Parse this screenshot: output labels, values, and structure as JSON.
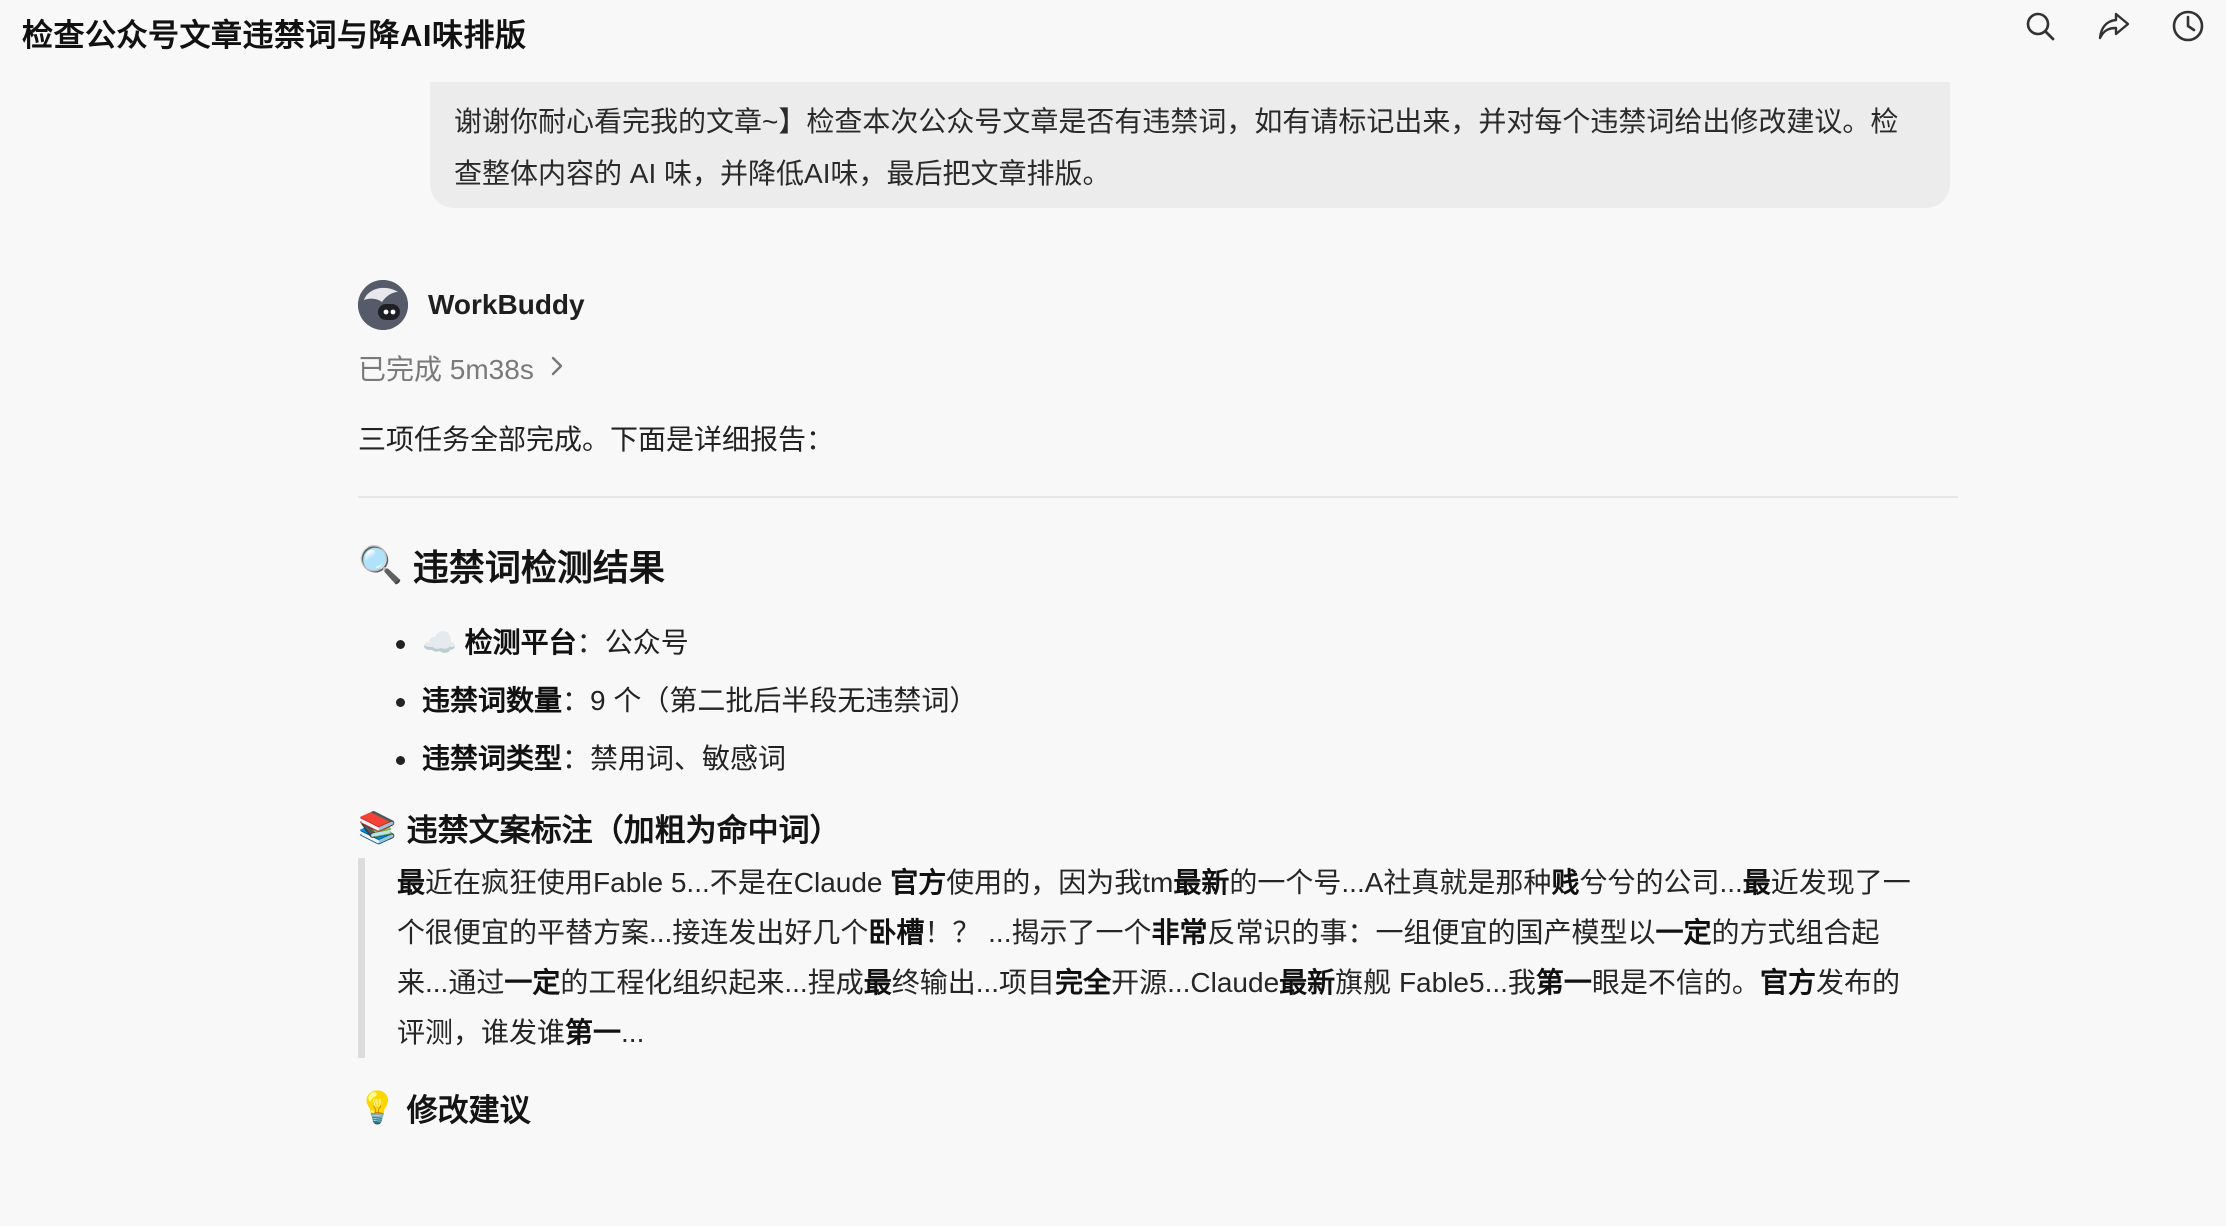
{
  "header": {
    "title": "检查公众号文章违禁词与降AI味排版",
    "icons": [
      "search-icon",
      "share-icon",
      "history-icon"
    ]
  },
  "user_message": {
    "text": "谢谢你耐心看完我的文章~】检查本次公众号文章是否有违禁词，如有请标记出来，并对每个违禁词给出修改建议。检查整体内容的 AI 味，并降低AI味，最后把文章排版。"
  },
  "agent": {
    "name": "WorkBuddy",
    "status": "已完成 5m38s",
    "intro": "三项任务全部完成。下面是详细报告："
  },
  "section_detect": {
    "emoji": "🔍",
    "title": "违禁词检测结果",
    "items": [
      {
        "emoji": "☁️",
        "label": "检测平台",
        "sep": "：",
        "value": "公众号"
      },
      {
        "emoji": "",
        "label": "违禁词数量",
        "sep": "：",
        "value": "9 个（第二批后半段无违禁词）"
      },
      {
        "emoji": "",
        "label": "违禁词类型",
        "sep": "：",
        "value": "禁用词、敏感词"
      }
    ]
  },
  "section_annotate": {
    "emoji": "📚",
    "title": "违禁文案标注（加粗为命中词）",
    "segments": [
      {
        "t": "最",
        "b": true
      },
      {
        "t": "近在疯狂使用Fable 5...不是在Claude ",
        "b": false
      },
      {
        "t": "官方",
        "b": true
      },
      {
        "t": "使用的，因为我tm",
        "b": false
      },
      {
        "t": "最新",
        "b": true
      },
      {
        "t": "的一个号...A社真就是那种",
        "b": false
      },
      {
        "t": "贱",
        "b": true
      },
      {
        "t": "兮兮的公司...",
        "b": false
      },
      {
        "t": "最",
        "b": true
      },
      {
        "t": "近发现了一个很便宜的平替方案...接连发出好几个",
        "b": false
      },
      {
        "t": "卧槽",
        "b": true
      },
      {
        "t": "！？ ...揭示了一个",
        "b": false
      },
      {
        "t": "非常",
        "b": true
      },
      {
        "t": "反常识的事：一组便宜的国产模型以",
        "b": false
      },
      {
        "t": "一定",
        "b": true
      },
      {
        "t": "的方式组合起来...通过",
        "b": false
      },
      {
        "t": "一定",
        "b": true
      },
      {
        "t": "的工程化组织起来...捏成",
        "b": false
      },
      {
        "t": "最",
        "b": true
      },
      {
        "t": "终输出...项目",
        "b": false
      },
      {
        "t": "完全",
        "b": true
      },
      {
        "t": "开源...Claude",
        "b": false
      },
      {
        "t": "最新",
        "b": true
      },
      {
        "t": "旗舰 Fable5...我",
        "b": false
      },
      {
        "t": "第一",
        "b": true
      },
      {
        "t": "眼是不信的。",
        "b": false
      },
      {
        "t": "官方",
        "b": true
      },
      {
        "t": "发布的评测，谁发谁",
        "b": false
      },
      {
        "t": "第一",
        "b": true
      },
      {
        "t": "...",
        "b": false
      }
    ]
  },
  "section_suggest": {
    "emoji": "💡",
    "title": "修改建议"
  }
}
